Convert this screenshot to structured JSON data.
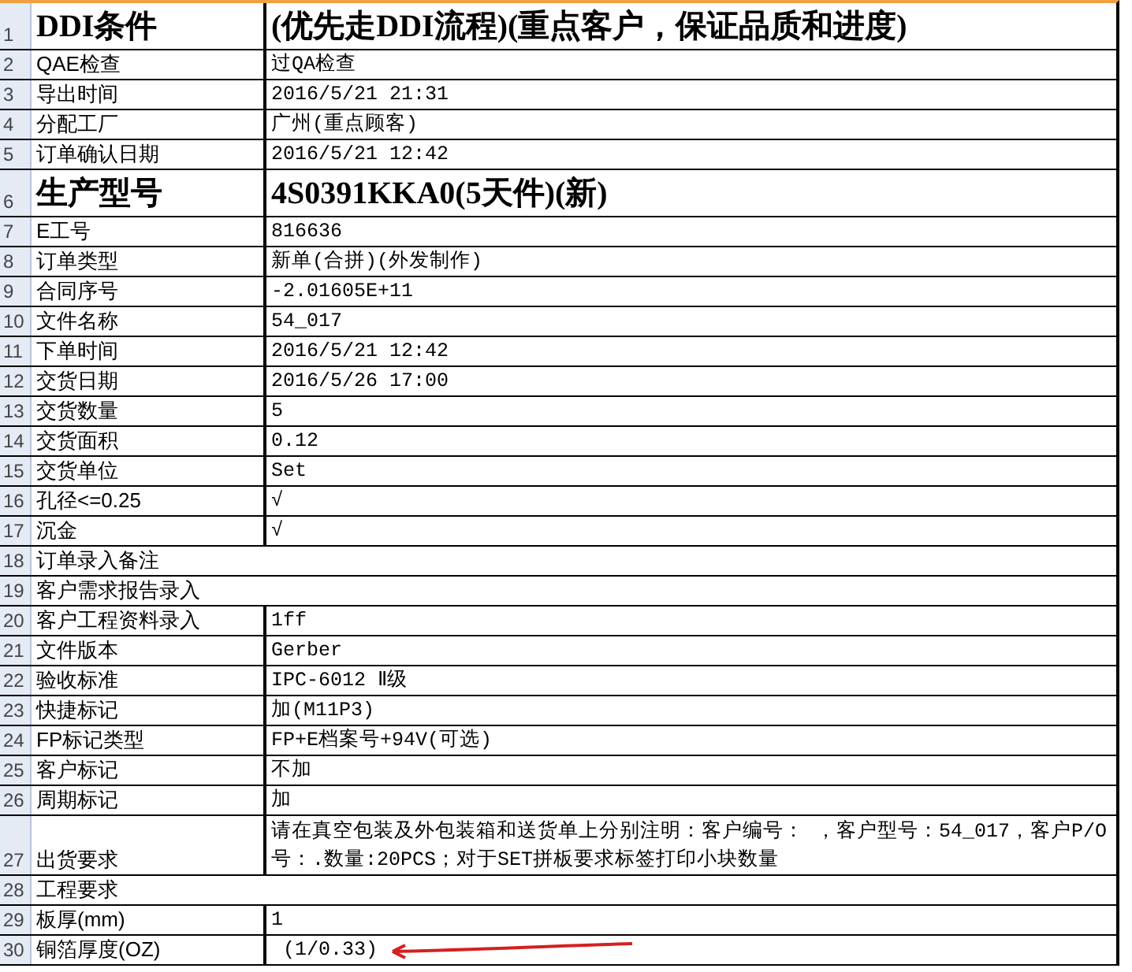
{
  "rows": [
    {
      "num": "1",
      "kind": "title",
      "label": "DDI条件",
      "value": "(优先走DDI流程)(重点客户，保证品质和进度)"
    },
    {
      "num": "2",
      "kind": "normal",
      "label": "QAE检查",
      "value": "过QA检查"
    },
    {
      "num": "3",
      "kind": "normal",
      "label": "导出时间",
      "value": "2016/5/21 21:31"
    },
    {
      "num": "4",
      "kind": "normal",
      "label": "分配工厂",
      "value": "广州(重点顾客)"
    },
    {
      "num": "5",
      "kind": "normal",
      "label": "订单确认日期",
      "value": "2016/5/21 12:42"
    },
    {
      "num": "6",
      "kind": "title",
      "label": "生产型号",
      "value": "4S0391KKA0(5天件)(新)"
    },
    {
      "num": "7",
      "kind": "normal",
      "label": "E工号",
      "value": "816636"
    },
    {
      "num": "8",
      "kind": "normal",
      "label": "订单类型",
      "value": "新单(合拼)(外发制作)"
    },
    {
      "num": "9",
      "kind": "normal",
      "label": "合同序号",
      "value": "-2.01605E+11"
    },
    {
      "num": "10",
      "kind": "normal",
      "label": "文件名称",
      "value": "54_017"
    },
    {
      "num": "11",
      "kind": "normal",
      "label": "下单时间",
      "value": "2016/5/21 12:42"
    },
    {
      "num": "12",
      "kind": "normal",
      "label": "交货日期",
      "value": "2016/5/26 17:00"
    },
    {
      "num": "13",
      "kind": "normal",
      "label": "交货数量",
      "value": "5"
    },
    {
      "num": "14",
      "kind": "normal",
      "label": "交货面积",
      "value": "0.12"
    },
    {
      "num": "15",
      "kind": "normal",
      "label": "交货单位",
      "value": "Set"
    },
    {
      "num": "16",
      "kind": "normal",
      "label": "孔径<=0.25",
      "value": "√"
    },
    {
      "num": "17",
      "kind": "normal",
      "label": "沉金",
      "value": "√"
    },
    {
      "num": "18",
      "kind": "merged",
      "label": "订单录入备注"
    },
    {
      "num": "19",
      "kind": "merged",
      "label": "客户需求报告录入"
    },
    {
      "num": "20",
      "kind": "normal",
      "label": "客户工程资料录入",
      "value": "1ff"
    },
    {
      "num": "21",
      "kind": "normal",
      "label": "文件版本",
      "value": "Gerber"
    },
    {
      "num": "22",
      "kind": "normal",
      "label": "验收标准",
      "value": "IPC-6012 Ⅱ级"
    },
    {
      "num": "23",
      "kind": "normal",
      "label": "快捷标记",
      "value": "加(M11P3)"
    },
    {
      "num": "24",
      "kind": "normal",
      "label": "FP标记类型",
      "value": "FP+E档案号+94V(可选)"
    },
    {
      "num": "25",
      "kind": "normal",
      "label": "客户标记",
      "value": "不加"
    },
    {
      "num": "26",
      "kind": "normal",
      "label": "周期标记",
      "value": "加"
    },
    {
      "num": "27",
      "kind": "tall",
      "label": "出货要求",
      "value": "请在真空包装及外包装箱和送货单上分别注明：客户编号： ，客户型号：54_017，客户P/O号：.数量:20PCS；对于SET拼板要求标签打印小块数量"
    },
    {
      "num": "28",
      "kind": "merged",
      "label": "工程要求"
    },
    {
      "num": "29",
      "kind": "normal",
      "label": "板厚(mm)",
      "value": "1"
    },
    {
      "num": "30",
      "kind": "arrow",
      "label": "铜箔厚度(OZ)",
      "value": " (1/0.33)"
    }
  ]
}
